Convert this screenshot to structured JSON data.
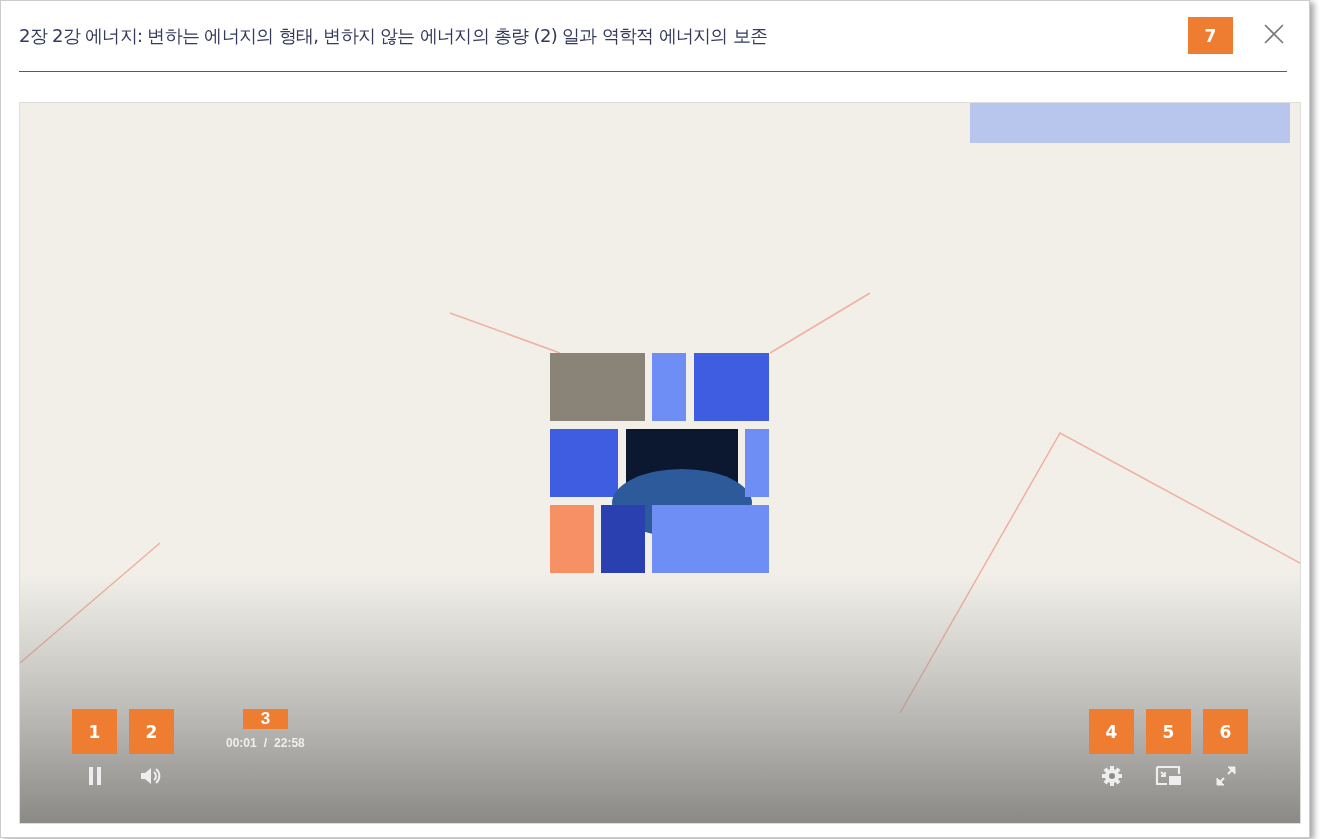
{
  "title": "2장 2강 에너지: 변하는 에너지의 형태, 변하지 않는 에너지의 총량 (2) 일과 역학적 에너지의 보존",
  "close_badge": "7",
  "player": {
    "playing": true,
    "current_time": "00:01",
    "separator": "/",
    "duration": "22:58",
    "controls": [
      {
        "kind": "play",
        "badge": "1"
      },
      {
        "kind": "volume",
        "badge": "2"
      },
      {
        "kind": "time",
        "badge": "3"
      },
      {
        "kind": "settings",
        "badge": "4"
      },
      {
        "kind": "pip",
        "badge": "5"
      },
      {
        "kind": "fullscreen",
        "badge": "6"
      }
    ]
  }
}
